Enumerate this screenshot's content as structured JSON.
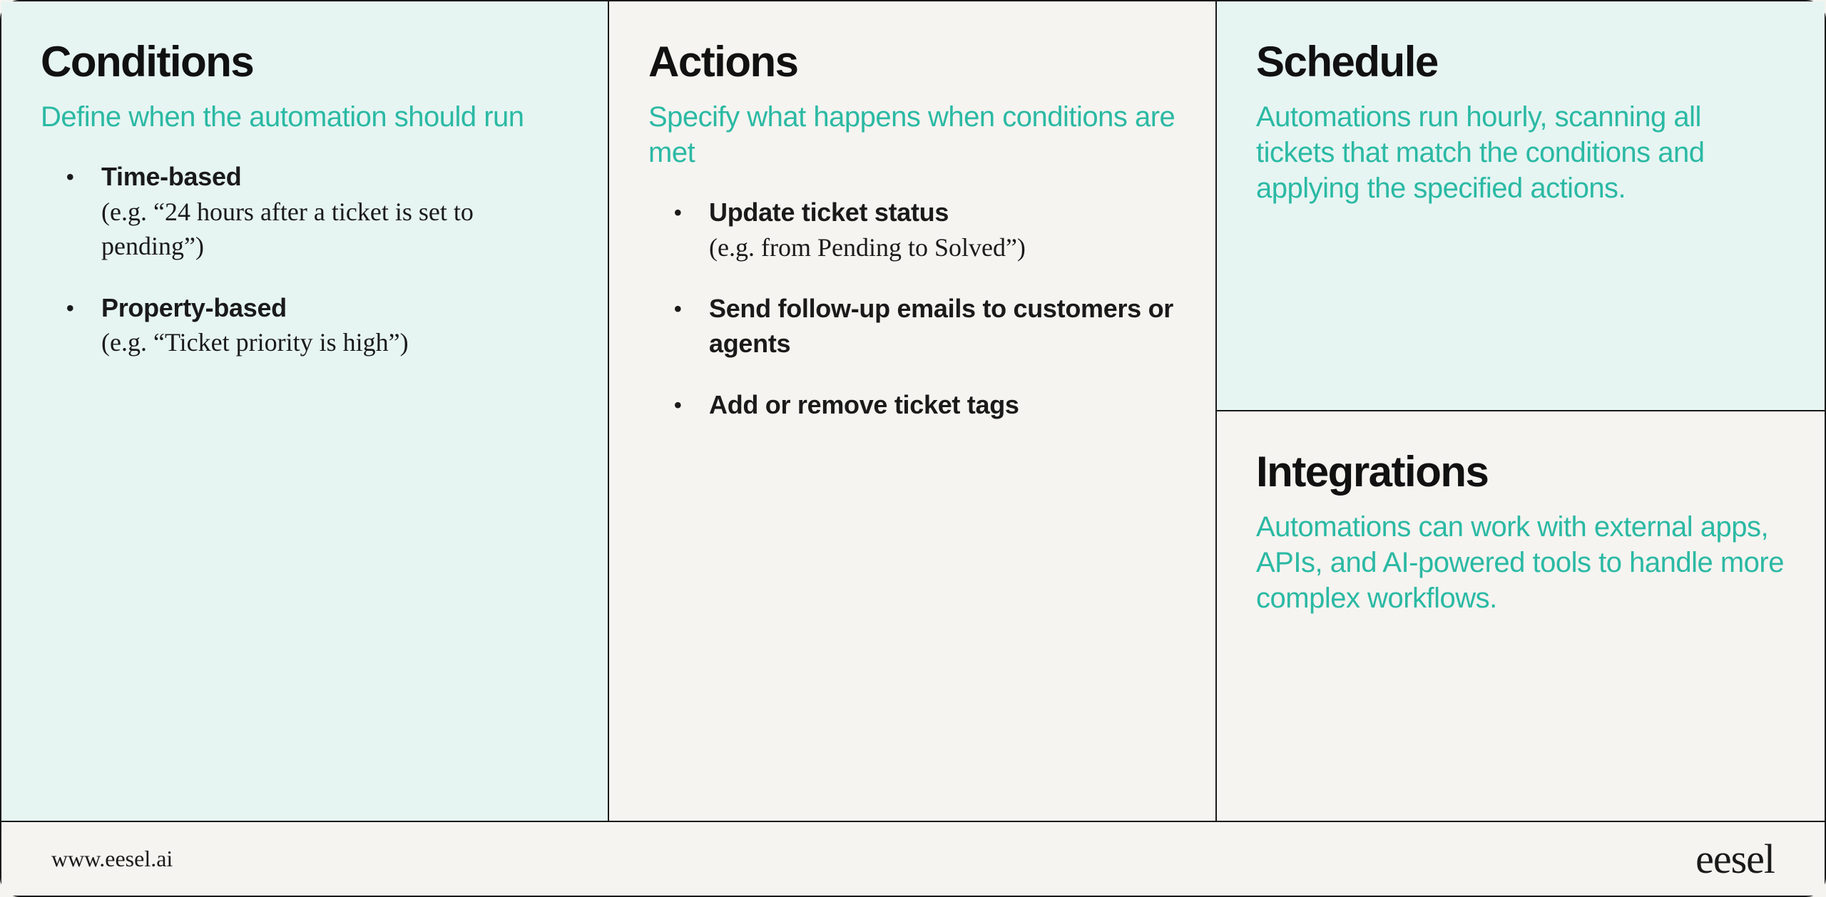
{
  "cards": {
    "conditions": {
      "title": "Conditions",
      "subtitle": "Define when the automation should run",
      "items": [
        {
          "title": "Time-based",
          "detail": "(e.g. “24 hours after a ticket is set to pending”)"
        },
        {
          "title": "Property-based",
          "detail": "(e.g. “Ticket priority is high”)"
        }
      ]
    },
    "actions": {
      "title": "Actions",
      "subtitle": "Specify what happens when conditions are met",
      "items": [
        {
          "title": "Update ticket status",
          "detail": "(e.g. from Pending to Solved”)"
        },
        {
          "title": "Send follow-up emails to customers or agents",
          "detail": ""
        },
        {
          "title": "Add or remove ticket tags",
          "detail": ""
        }
      ]
    },
    "schedule": {
      "title": "Schedule",
      "subtitle": "Automations run hourly, scanning all tickets that match the conditions and applying the specified actions."
    },
    "integrations": {
      "title": "Integrations",
      "subtitle": "Automations can work with external apps, APIs, and AI-powered tools to handle more complex workflows."
    }
  },
  "footer": {
    "url": "www.eesel.ai",
    "brand": "eesel"
  }
}
